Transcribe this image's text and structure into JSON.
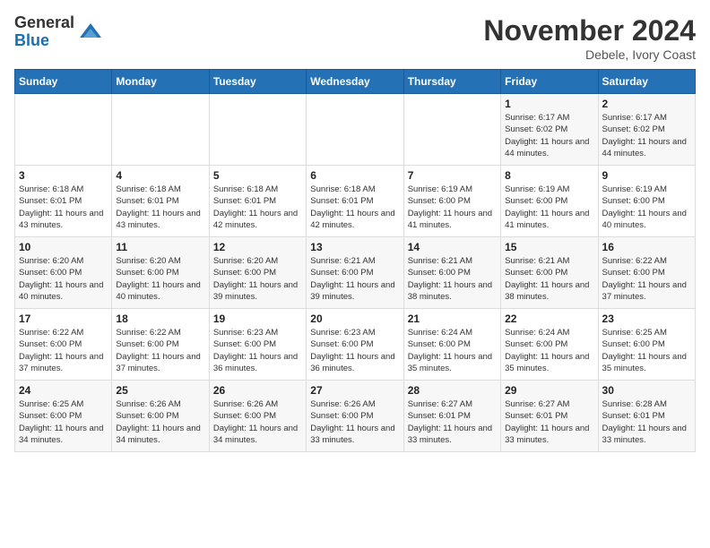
{
  "logo": {
    "general": "General",
    "blue": "Blue"
  },
  "title": "November 2024",
  "location": "Debele, Ivory Coast",
  "days_of_week": [
    "Sunday",
    "Monday",
    "Tuesday",
    "Wednesday",
    "Thursday",
    "Friday",
    "Saturday"
  ],
  "weeks": [
    [
      {
        "num": "",
        "info": ""
      },
      {
        "num": "",
        "info": ""
      },
      {
        "num": "",
        "info": ""
      },
      {
        "num": "",
        "info": ""
      },
      {
        "num": "",
        "info": ""
      },
      {
        "num": "1",
        "info": "Sunrise: 6:17 AM\nSunset: 6:02 PM\nDaylight: 11 hours and 44 minutes."
      },
      {
        "num": "2",
        "info": "Sunrise: 6:17 AM\nSunset: 6:02 PM\nDaylight: 11 hours and 44 minutes."
      }
    ],
    [
      {
        "num": "3",
        "info": "Sunrise: 6:18 AM\nSunset: 6:01 PM\nDaylight: 11 hours and 43 minutes."
      },
      {
        "num": "4",
        "info": "Sunrise: 6:18 AM\nSunset: 6:01 PM\nDaylight: 11 hours and 43 minutes."
      },
      {
        "num": "5",
        "info": "Sunrise: 6:18 AM\nSunset: 6:01 PM\nDaylight: 11 hours and 42 minutes."
      },
      {
        "num": "6",
        "info": "Sunrise: 6:18 AM\nSunset: 6:01 PM\nDaylight: 11 hours and 42 minutes."
      },
      {
        "num": "7",
        "info": "Sunrise: 6:19 AM\nSunset: 6:00 PM\nDaylight: 11 hours and 41 minutes."
      },
      {
        "num": "8",
        "info": "Sunrise: 6:19 AM\nSunset: 6:00 PM\nDaylight: 11 hours and 41 minutes."
      },
      {
        "num": "9",
        "info": "Sunrise: 6:19 AM\nSunset: 6:00 PM\nDaylight: 11 hours and 40 minutes."
      }
    ],
    [
      {
        "num": "10",
        "info": "Sunrise: 6:20 AM\nSunset: 6:00 PM\nDaylight: 11 hours and 40 minutes."
      },
      {
        "num": "11",
        "info": "Sunrise: 6:20 AM\nSunset: 6:00 PM\nDaylight: 11 hours and 40 minutes."
      },
      {
        "num": "12",
        "info": "Sunrise: 6:20 AM\nSunset: 6:00 PM\nDaylight: 11 hours and 39 minutes."
      },
      {
        "num": "13",
        "info": "Sunrise: 6:21 AM\nSunset: 6:00 PM\nDaylight: 11 hours and 39 minutes."
      },
      {
        "num": "14",
        "info": "Sunrise: 6:21 AM\nSunset: 6:00 PM\nDaylight: 11 hours and 38 minutes."
      },
      {
        "num": "15",
        "info": "Sunrise: 6:21 AM\nSunset: 6:00 PM\nDaylight: 11 hours and 38 minutes."
      },
      {
        "num": "16",
        "info": "Sunrise: 6:22 AM\nSunset: 6:00 PM\nDaylight: 11 hours and 37 minutes."
      }
    ],
    [
      {
        "num": "17",
        "info": "Sunrise: 6:22 AM\nSunset: 6:00 PM\nDaylight: 11 hours and 37 minutes."
      },
      {
        "num": "18",
        "info": "Sunrise: 6:22 AM\nSunset: 6:00 PM\nDaylight: 11 hours and 37 minutes."
      },
      {
        "num": "19",
        "info": "Sunrise: 6:23 AM\nSunset: 6:00 PM\nDaylight: 11 hours and 36 minutes."
      },
      {
        "num": "20",
        "info": "Sunrise: 6:23 AM\nSunset: 6:00 PM\nDaylight: 11 hours and 36 minutes."
      },
      {
        "num": "21",
        "info": "Sunrise: 6:24 AM\nSunset: 6:00 PM\nDaylight: 11 hours and 35 minutes."
      },
      {
        "num": "22",
        "info": "Sunrise: 6:24 AM\nSunset: 6:00 PM\nDaylight: 11 hours and 35 minutes."
      },
      {
        "num": "23",
        "info": "Sunrise: 6:25 AM\nSunset: 6:00 PM\nDaylight: 11 hours and 35 minutes."
      }
    ],
    [
      {
        "num": "24",
        "info": "Sunrise: 6:25 AM\nSunset: 6:00 PM\nDaylight: 11 hours and 34 minutes."
      },
      {
        "num": "25",
        "info": "Sunrise: 6:26 AM\nSunset: 6:00 PM\nDaylight: 11 hours and 34 minutes."
      },
      {
        "num": "26",
        "info": "Sunrise: 6:26 AM\nSunset: 6:00 PM\nDaylight: 11 hours and 34 minutes."
      },
      {
        "num": "27",
        "info": "Sunrise: 6:26 AM\nSunset: 6:00 PM\nDaylight: 11 hours and 33 minutes."
      },
      {
        "num": "28",
        "info": "Sunrise: 6:27 AM\nSunset: 6:01 PM\nDaylight: 11 hours and 33 minutes."
      },
      {
        "num": "29",
        "info": "Sunrise: 6:27 AM\nSunset: 6:01 PM\nDaylight: 11 hours and 33 minutes."
      },
      {
        "num": "30",
        "info": "Sunrise: 6:28 AM\nSunset: 6:01 PM\nDaylight: 11 hours and 33 minutes."
      }
    ]
  ]
}
